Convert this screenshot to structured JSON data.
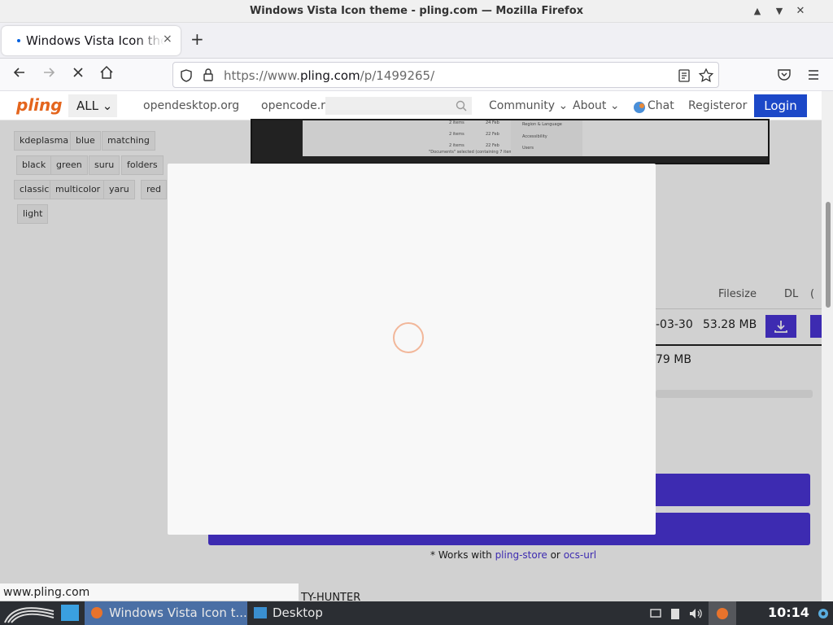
{
  "window": {
    "title": "Windows Vista Icon theme - pling.com — Mozilla Firefox",
    "controls": [
      "▲",
      "▼",
      "✕"
    ]
  },
  "tabs": [
    {
      "title": "Windows Vista Icon theme - pling.com",
      "close": "×"
    }
  ],
  "newtab": "+",
  "nav": {
    "url_prefix": "https://www.",
    "url_domain": "pling.com",
    "url_path": "/p/1499265/"
  },
  "site": {
    "logo": "pling",
    "all_label": "ALL ⌄",
    "links": [
      "opendesktop.org",
      "opencode.r"
    ],
    "menu": [
      "Community ⌄",
      "About ⌄",
      "Chat"
    ],
    "register": "Register",
    "or": "or",
    "login": "Login"
  },
  "tags": [
    "kdeplasma",
    "blue",
    "matching",
    "black",
    "green",
    "suru",
    "folders",
    "classic",
    "multicolor",
    "yaru",
    "red",
    "light"
  ],
  "files": {
    "headers": [
      "Filesize",
      "DL",
      "("
    ],
    "rows": [
      {
        "date": "-03-30",
        "size": "53.28 MB"
      },
      {
        "date": "",
        "size": "79 MB"
      }
    ]
  },
  "preview_texts": [
    "2 items",
    "24 Feb",
    "2 items",
    "22 Feb",
    "2 items",
    "22 Feb",
    "\"Documents\" selected (containing 7 items)",
    "Region & Language",
    "Accessibility",
    "Users"
  ],
  "works_with": {
    "prefix": "* Works with",
    "link1": "pling-store",
    "or": "or",
    "link2": "ocs-url"
  },
  "bottom_partial": "TY-HUNTER",
  "status_url": "www.pling.com",
  "taskbar": {
    "window1": "Windows Vista Icon t...",
    "window2": "Desktop",
    "clock": "10:14"
  },
  "colors": {
    "accent": "#4b35d8",
    "login": "#1c48c8",
    "spinner": "#f2b79a"
  }
}
